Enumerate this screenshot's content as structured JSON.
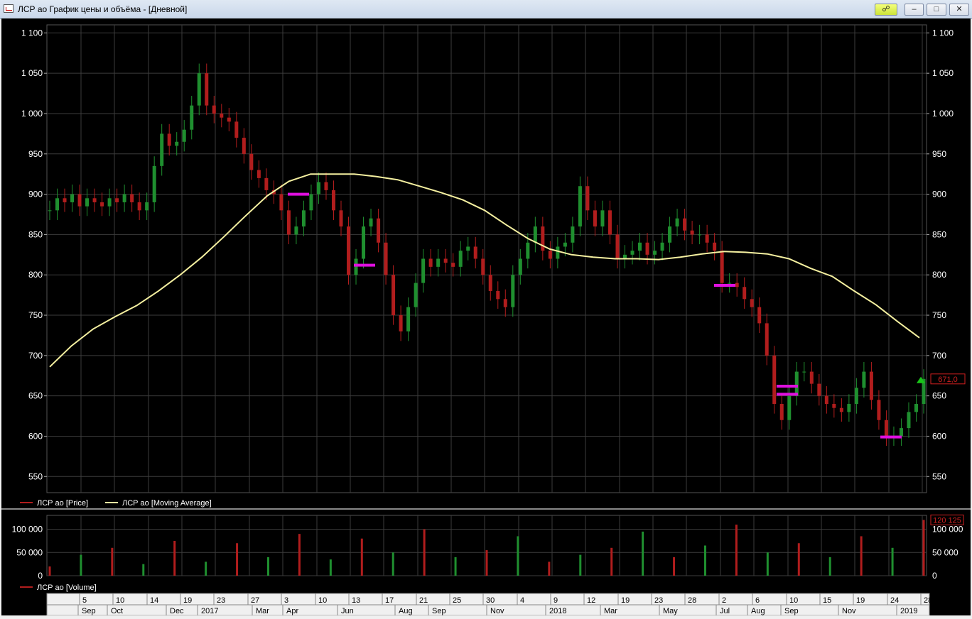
{
  "window": {
    "title": "ЛСР ао График цены и объёма - [Дневной]",
    "buttons": {
      "minimize": "▁",
      "maximize": "□",
      "close": "✕",
      "link": "🔗"
    }
  },
  "colors": {
    "background": "#000000",
    "grid": "#3c3c3c",
    "candle_up": "#1f8f2f",
    "candle_down": "#b11d1d",
    "moving_average": "#f5f0a0",
    "signal": "#e010e0",
    "last_price_marker": "#19c519",
    "axis_text": "#ffffff",
    "last_label_border": "#d02020"
  },
  "price_panel": {
    "y_ticks": [
      "1 100",
      "1 050",
      "1 000",
      "950",
      "900",
      "850",
      "800",
      "750",
      "700",
      "650",
      "600",
      "550"
    ],
    "y_tick_values": [
      1100,
      1050,
      1000,
      950,
      900,
      850,
      800,
      750,
      700,
      650,
      600,
      550
    ],
    "last_price_label": "671,0",
    "legend": [
      {
        "label": "ЛСР ао [Price]",
        "color": "#b11d1d"
      },
      {
        "label": "ЛСР ао [Moving Average]",
        "color": "#f5f0a0"
      }
    ]
  },
  "volume_panel": {
    "y_ticks": [
      "100 000",
      "50 000",
      "0"
    ],
    "y_tick_values": [
      100000,
      50000,
      0
    ],
    "last_volume_label": "120 125",
    "legend": [
      {
        "label": "ЛСР ао [Volume]",
        "color": "#b11d1d"
      }
    ]
  },
  "time_axis": {
    "days": [
      "5",
      "10",
      "14",
      "19",
      "23",
      "27",
      "3",
      "10",
      "13",
      "17",
      "21",
      "25",
      "30",
      "4",
      "9",
      "12",
      "19",
      "23",
      "28",
      "2",
      "6",
      "10",
      "15",
      "19",
      "24",
      "28"
    ],
    "months": [
      "Sep",
      "Oct",
      "Dec",
      "2017",
      "Mar",
      "Apr",
      "Jun",
      "Aug",
      "Sep",
      "Nov",
      "2018",
      "Mar",
      "May",
      "Jul",
      "Aug",
      "Sep",
      "Nov",
      "2019"
    ]
  },
  "chart_data": {
    "type": "line",
    "title": "ЛСР ао График цены и объёма",
    "ylim": [
      530,
      1110
    ],
    "volume_ylim": [
      0,
      130000
    ],
    "series": [
      {
        "name": "ЛСР ао [Price]",
        "values": [
          880,
          895,
          890,
          900,
          885,
          895,
          890,
          885,
          895,
          890,
          900,
          890,
          880,
          890,
          935,
          975,
          960,
          965,
          980,
          1010,
          1050,
          1010,
          1000,
          995,
          990,
          970,
          950,
          930,
          920,
          905,
          900,
          880,
          850,
          860,
          880,
          900,
          915,
          905,
          880,
          860,
          800,
          820,
          860,
          870,
          840,
          800,
          750,
          730,
          760,
          790,
          820,
          810,
          820,
          815,
          810,
          830,
          835,
          820,
          800,
          780,
          770,
          760,
          800,
          820,
          840,
          860,
          830,
          820,
          835,
          840,
          860,
          910,
          880,
          860,
          880,
          850,
          820,
          825,
          830,
          840,
          825,
          830,
          840,
          860,
          870,
          855,
          850,
          850,
          840,
          830,
          790,
          790,
          785,
          770,
          760,
          740,
          700,
          640,
          620,
          650,
          680,
          680,
          665,
          650,
          640,
          635,
          630,
          640,
          660,
          680,
          645,
          620,
          600,
          600,
          610,
          630,
          640,
          671
        ]
      },
      {
        "name": "ЛСР ао [Moving Average]",
        "values": [
          686,
          712,
          733,
          748,
          762,
          780,
          800,
          822,
          847,
          873,
          898,
          916,
          925,
          925,
          925,
          922,
          918,
          910,
          902,
          893,
          880,
          862,
          845,
          832,
          825,
          822,
          820,
          820,
          819,
          822,
          826,
          829,
          828,
          826,
          820,
          808,
          798,
          780,
          763,
          742,
          722
        ]
      },
      {
        "name": "ЛСР ао [Volume]",
        "values": [
          20000,
          45000,
          60000,
          25000,
          75000,
          30000,
          70000,
          40000,
          90000,
          35000,
          80000,
          50000,
          100000,
          40000,
          55000,
          85000,
          30000,
          45000,
          60000,
          95000,
          40000,
          65000,
          110000,
          50000,
          70000,
          40000,
          85000,
          60000,
          120125
        ]
      }
    ],
    "signals": [
      900,
      812,
      787,
      662,
      652,
      599
    ]
  }
}
